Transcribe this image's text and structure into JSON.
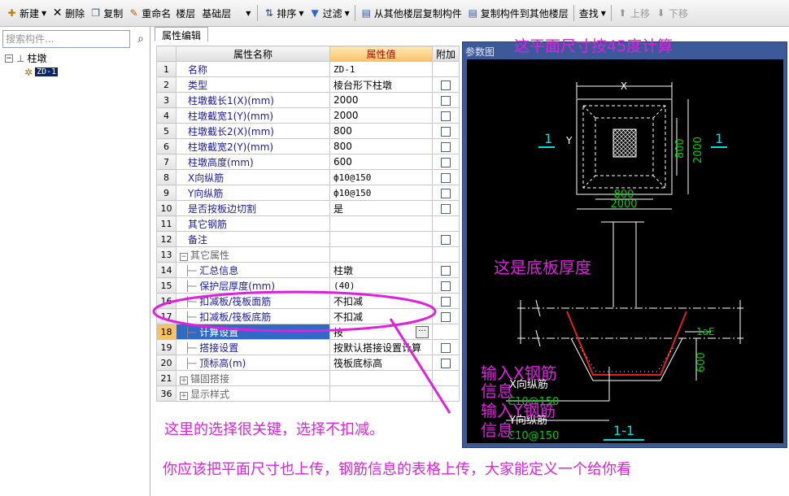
{
  "toolbar": {
    "new_label": "新建",
    "delete_label": "删除",
    "copy_label": "复制",
    "rename_label": "重命名",
    "floor_label": "楼层",
    "floor_value": "基础层",
    "sort_label": "排序",
    "filter_label": "过滤",
    "copy_from_floor_label": "从其他楼层复制构件",
    "copy_to_floor_label": "复制构件到其他楼层",
    "find_label": "查找",
    "move_up_label": "上移",
    "move_down_label": "下移"
  },
  "search": {
    "placeholder": "搜索构件..."
  },
  "tree": {
    "root_label": "柱墩",
    "child_label": "ZD-1"
  },
  "property_editor": {
    "tab_label": "属性编辑",
    "headers": {
      "name": "属性名称",
      "value": "属性值",
      "extra": "附加"
    },
    "rows": [
      {
        "num": "1",
        "name": "名称",
        "value": "ZD-1"
      },
      {
        "num": "2",
        "name": "类型",
        "value": "棱台形下柱墩"
      },
      {
        "num": "3",
        "name": "柱墩截长1(X)(mm)",
        "value": "2000"
      },
      {
        "num": "4",
        "name": "柱墩截宽1(Y)(mm)",
        "value": "2000"
      },
      {
        "num": "5",
        "name": "柱墩截长2(X)(mm)",
        "value": "800"
      },
      {
        "num": "6",
        "name": "柱墩截宽2(Y)(mm)",
        "value": "800"
      },
      {
        "num": "7",
        "name": "柱墩高度(mm)",
        "value": "600"
      },
      {
        "num": "8",
        "name": "X向纵筋",
        "value": "ф10@150"
      },
      {
        "num": "9",
        "name": "Y向纵筋",
        "value": "ф10@150"
      },
      {
        "num": "10",
        "name": "是否按板边切割",
        "value": "是"
      },
      {
        "num": "11",
        "name": "其它钢筋",
        "value": ""
      },
      {
        "num": "12",
        "name": "备注",
        "value": ""
      },
      {
        "num": "13",
        "name": "其它属性",
        "value": ""
      },
      {
        "num": "14",
        "name": "汇总信息",
        "value": "柱墩"
      },
      {
        "num": "15",
        "name": "保护层厚度(mm)",
        "value": "(40)"
      },
      {
        "num": "16",
        "name": "扣减板/筏板面筋",
        "value": "不扣减"
      },
      {
        "num": "17",
        "name": "扣减板/筏板底筋",
        "value": "不扣减"
      },
      {
        "num": "18",
        "name": "计算设置",
        "value": "按"
      },
      {
        "num": "19",
        "name": "搭接设置",
        "value": "按默认搭接设置计算"
      },
      {
        "num": "20",
        "name": "顶标高(m)",
        "value": "筏板底标高"
      },
      {
        "num": "21",
        "name": "锚固搭接",
        "value": ""
      },
      {
        "num": "36",
        "name": "显示样式",
        "value": ""
      }
    ]
  },
  "drawing": {
    "title": "参数图",
    "labels": {
      "x": "X",
      "y": "Y",
      "sec": "1",
      "dim_800": "800",
      "dim_2000": "2000",
      "lae": "1aE",
      "dim_600": "600",
      "xbar": "X向纵筋",
      "xbar_spec": "C10@150",
      "ybar": "Y向纵筋",
      "ybar_spec": "C10@150",
      "section": "1-1"
    }
  },
  "annotations": {
    "top": "这平面尺寸按45度计算",
    "slab": "这是底板厚度",
    "xinput_1": "输入X钢筋",
    "xinput_2": "信息",
    "yinput_1": "输入Y钢筋",
    "yinput_2": "信息",
    "choice": "这里的选择很关键，选择不扣减。",
    "bottom": "你应该把平面尺寸也上传，钢筋信息的表格上传，大家能定义一个给你看"
  },
  "colors": {
    "annotation": "#e020e0",
    "selection": "#316ac5",
    "drawing_bg": "#000000",
    "panel": "#3c5a9a"
  }
}
